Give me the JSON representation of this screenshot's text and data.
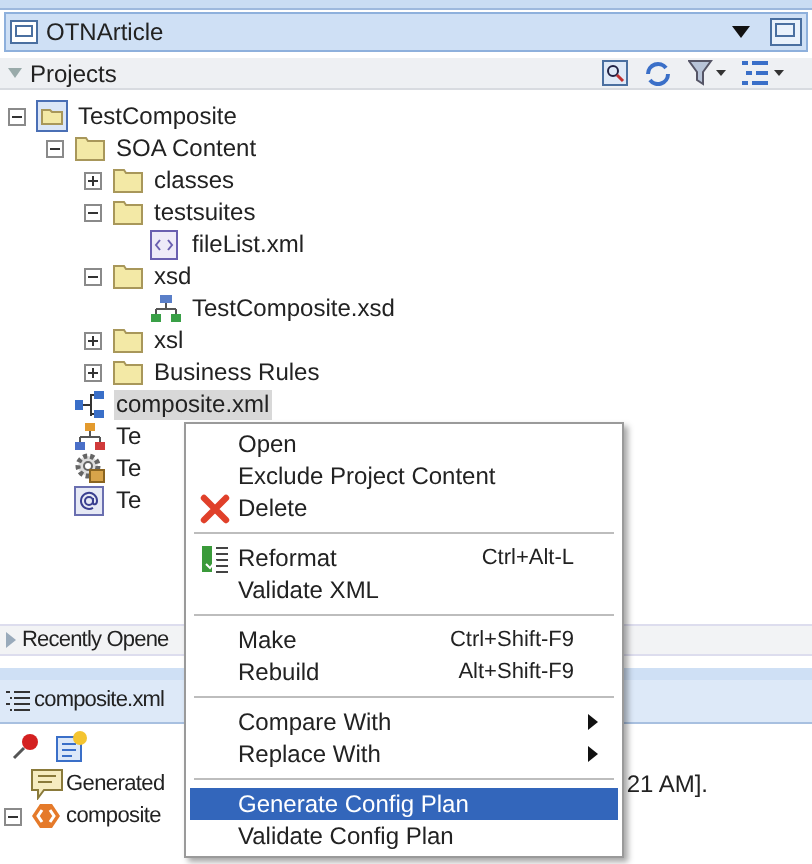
{
  "app_header": {
    "title": "OTNArticle"
  },
  "projects_panel": {
    "title": "Projects",
    "tree": [
      {
        "label": "TestComposite",
        "kind": "project",
        "expanded": true,
        "selected": false,
        "children": [
          {
            "label": "SOA Content",
            "kind": "folder",
            "expanded": true,
            "selected": false,
            "children": [
              {
                "label": "classes",
                "kind": "folder",
                "expanded": false,
                "selected": false
              },
              {
                "label": "testsuites",
                "kind": "folder",
                "expanded": true,
                "selected": false,
                "children": [
                  {
                    "label": "fileList.xml",
                    "kind": "xml",
                    "selected": false
                  }
                ]
              },
              {
                "label": "xsd",
                "kind": "folder",
                "expanded": true,
                "selected": false,
                "children": [
                  {
                    "label": "TestComposite.xsd",
                    "kind": "schema",
                    "selected": false
                  }
                ]
              },
              {
                "label": "xsl",
                "kind": "folder",
                "expanded": false,
                "selected": false
              },
              {
                "label": "Business Rules",
                "kind": "folder",
                "expanded": false,
                "selected": false
              }
            ]
          },
          {
            "label": "composite.xml",
            "kind": "composite",
            "selected": true
          },
          {
            "label": "Te",
            "kind": "component",
            "selected": false
          },
          {
            "label": "Te",
            "kind": "config",
            "selected": false
          },
          {
            "label": "Te",
            "kind": "email",
            "selected": false
          }
        ]
      }
    ]
  },
  "recent_panel": {
    "title": "Recently Opene",
    "expanded": false
  },
  "structure_panel": {
    "tab": "composite.xml",
    "rows": [
      {
        "label": "Generated",
        "kind": "comment"
      },
      {
        "label": "composite",
        "kind": "element",
        "expanded": true
      }
    ],
    "trailing_text": "21 AM]."
  },
  "context_menu": {
    "groups": [
      [
        {
          "label": "Open",
          "kind": "plain",
          "selected": false
        },
        {
          "label": "Exclude Project Content",
          "kind": "plain",
          "selected": false
        },
        {
          "label": "Delete",
          "kind": "delete",
          "selected": false
        }
      ],
      [
        {
          "label": "Reformat",
          "kind": "reformat",
          "shortcut": "Ctrl+Alt-L",
          "selected": false
        },
        {
          "label": "Validate XML",
          "kind": "plain",
          "selected": false
        }
      ],
      [
        {
          "label": "Make",
          "kind": "plain",
          "shortcut": "Ctrl+Shift-F9",
          "selected": false
        },
        {
          "label": "Rebuild",
          "kind": "plain",
          "shortcut": "Alt+Shift-F9",
          "selected": false
        }
      ],
      [
        {
          "label": "Compare With",
          "kind": "submenu",
          "selected": false
        },
        {
          "label": "Replace With",
          "kind": "submenu",
          "selected": false
        }
      ],
      [
        {
          "label": "Generate Config Plan",
          "kind": "plain",
          "selected": true
        },
        {
          "label": "Validate Config Plan",
          "kind": "plain",
          "selected": false
        }
      ]
    ]
  }
}
